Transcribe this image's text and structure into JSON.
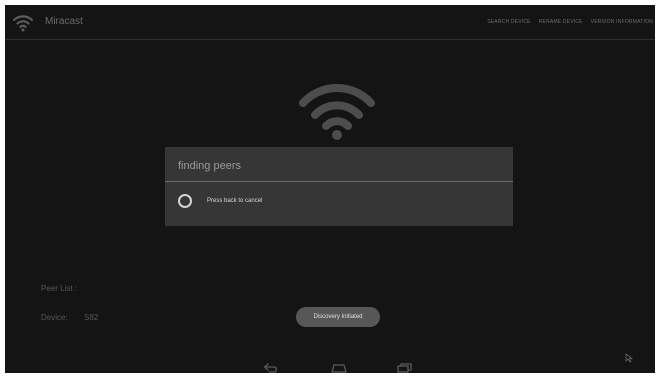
{
  "app": {
    "title": "Miracast",
    "icon": "wifi-icon"
  },
  "menu": {
    "search_label": "SEARCH DEVICE",
    "rename_label": "RENAME DEVICE",
    "version_label": "VERSION INFORMATION"
  },
  "dialog": {
    "title": "finding peers",
    "message": "Press back to cancel",
    "spinner_icon": "progress-spinner-icon"
  },
  "peer_list": {
    "label": "Peer List :",
    "device_label": "Device:",
    "device_value": "S82"
  },
  "toast": {
    "text": "Discovery Initiated"
  },
  "nav": {
    "icons": [
      "back-icon",
      "home-icon",
      "recents-icon"
    ]
  },
  "colors": {
    "background": "#141414",
    "dialog": "#363636",
    "toast": "#575757",
    "wifi_icon": "#4d4d4d"
  }
}
